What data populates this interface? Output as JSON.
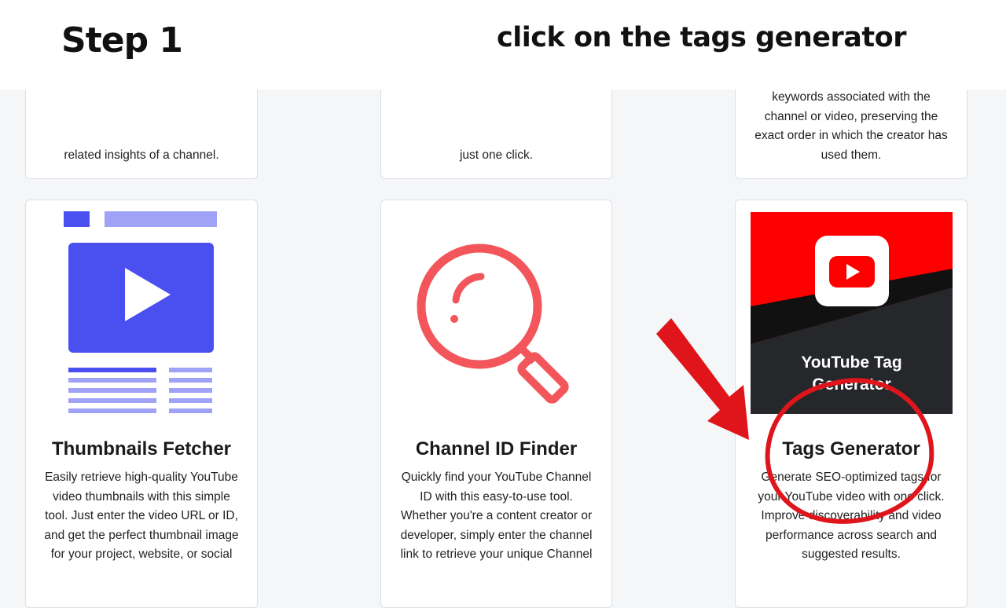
{
  "banner": {
    "step": "Step 1",
    "instruction": "click on the tags generator"
  },
  "top_cards": [
    {
      "desc_lines": [
        "related insights of a channel."
      ]
    },
    {
      "desc_lines": [
        "just one click."
      ]
    },
    {
      "desc_lines": [
        "keywords associated with the",
        "channel or video, preserving the",
        "exact order in which the creator has",
        "used them."
      ]
    }
  ],
  "tools": [
    {
      "title": "Thumbnails Fetcher",
      "desc_lines": [
        "Easily retrieve high-quality YouTube",
        "video thumbnails with this simple",
        "tool. Just enter the video URL or ID,",
        "and get the perfect thumbnail image",
        "for your project, website, or social"
      ]
    },
    {
      "title": "Channel ID Finder",
      "desc_lines": [
        "Quickly find your YouTube Channel",
        "ID with this easy-to-use tool.",
        "Whether you're a content creator or",
        "developer, simply enter the channel",
        "link to retrieve your unique Channel"
      ]
    },
    {
      "title": "Tags Generator",
      "image_text_lines": [
        "YouTube Tag",
        "Generator"
      ],
      "desc_lines": [
        "Generate SEO-optimized tags for",
        "your YouTube video with one click.",
        "Improve discoverability and video",
        "performance across search and",
        "suggested results."
      ]
    }
  ],
  "colors": {
    "annotation_red": "#e0151b",
    "thumbnail_blue": "#4a4ff0",
    "thumbnail_light": "#9fa2f7",
    "magnifier_red": "#f2555a",
    "youtube_red": "#ff0000",
    "dark_panel": "#26272b"
  },
  "icons": [
    "thumbnail-illustration",
    "magnifier-icon",
    "youtube-play-icon",
    "arrow-annotation",
    "circle-annotation"
  ]
}
